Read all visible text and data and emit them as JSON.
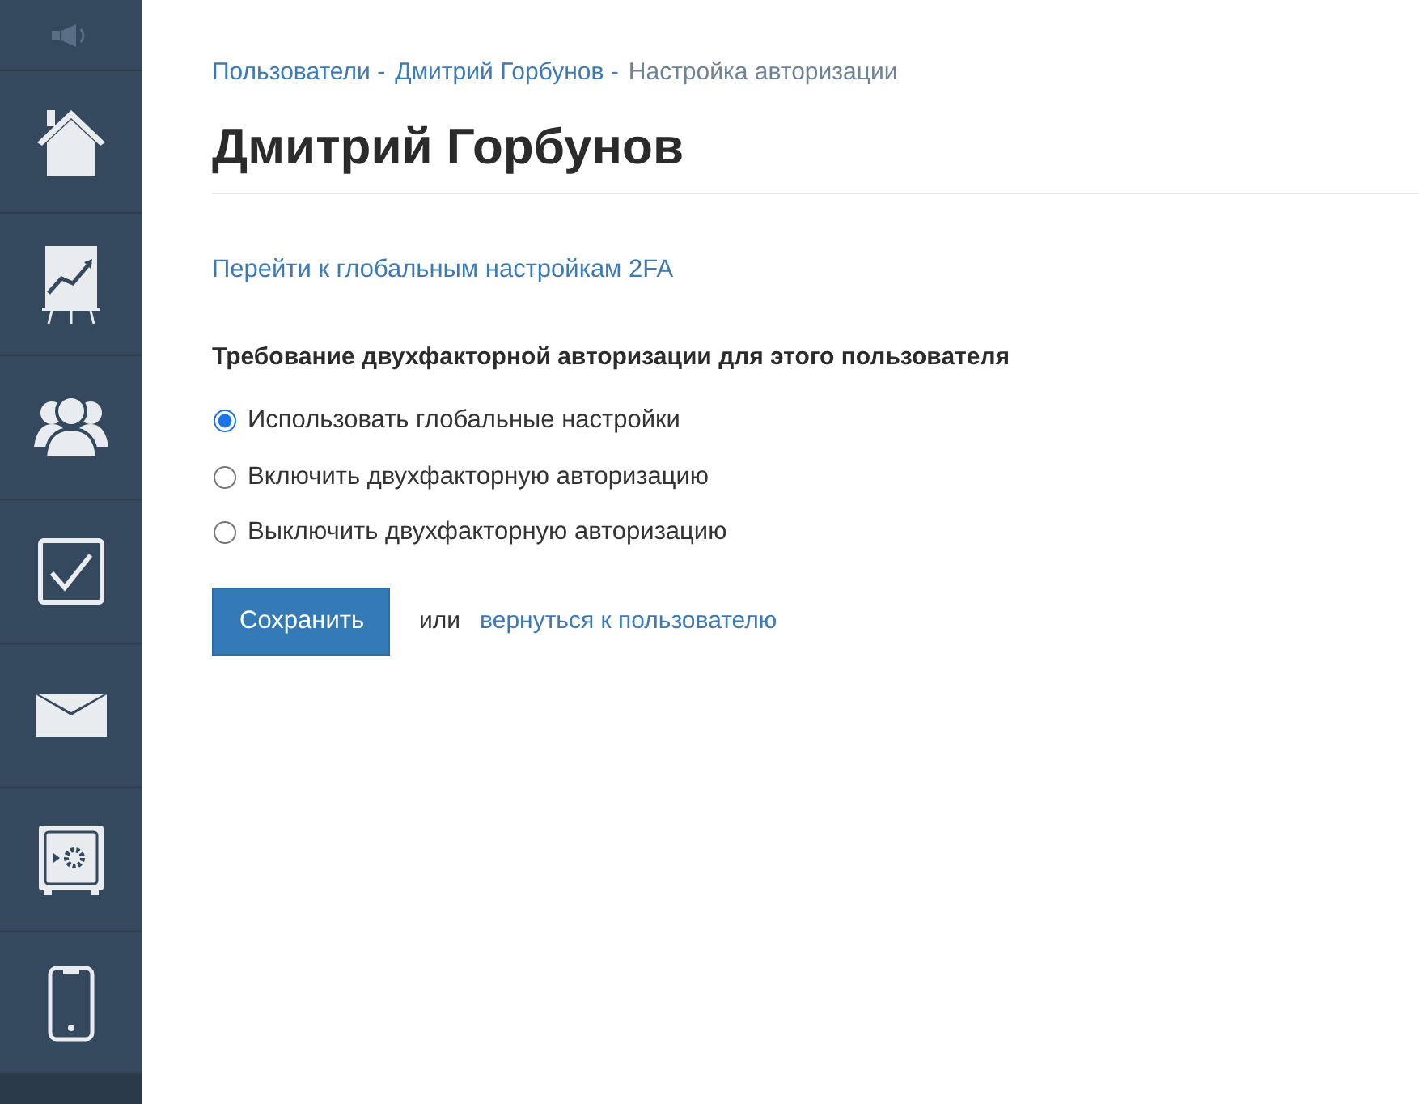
{
  "breadcrumbs": [
    {
      "label": "Пользователи -",
      "kind": "link"
    },
    {
      "label": "Дмитрий Горбунов -",
      "kind": "link"
    },
    {
      "label": "Настройка авторизации",
      "kind": "current"
    }
  ],
  "title": "Дмитрий Горбунов",
  "global_link": "Перейти к глобальным настройкам 2FA",
  "section_title": "Требование двухфакторной авторизации для этого пользователя",
  "options": [
    {
      "label": "Использовать глобальные настройки",
      "selected": true
    },
    {
      "label": "Включить двухфакторную авторизацию",
      "selected": false
    },
    {
      "label": "Выключить двухфакторную авторизацию",
      "selected": false
    }
  ],
  "save_button": "Сохранить",
  "or_text": "или",
  "back_link": "вернуться к пользователю"
}
